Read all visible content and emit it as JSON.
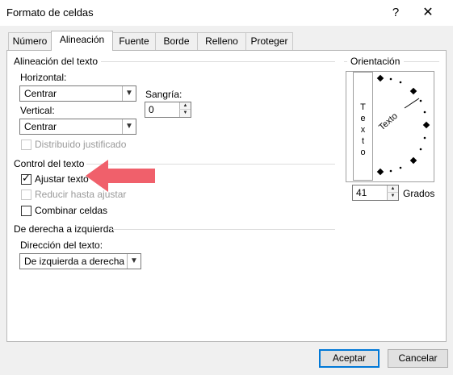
{
  "window": {
    "title": "Formato de celdas",
    "help_label": "?",
    "close_label": "✕"
  },
  "tabs": [
    {
      "label": "Número"
    },
    {
      "label": "Alineación"
    },
    {
      "label": "Fuente"
    },
    {
      "label": "Borde"
    },
    {
      "label": "Relleno"
    },
    {
      "label": "Proteger"
    }
  ],
  "active_tab": "Alineación",
  "text_alignment": {
    "group_title": "Alineación del texto",
    "horizontal_label": "Horizontal:",
    "horizontal_value": "Centrar",
    "indent_label": "Sangría:",
    "indent_value": "0",
    "vertical_label": "Vertical:",
    "vertical_value": "Centrar",
    "distributed_label": "Distribuido justificado",
    "distributed_checked": false,
    "distributed_enabled": false
  },
  "text_control": {
    "group_title": "Control del texto",
    "wrap_label": "Ajustar texto",
    "wrap_checked": true,
    "shrink_label": "Reducir hasta ajustar",
    "shrink_checked": false,
    "shrink_enabled": false,
    "merge_label": "Combinar celdas",
    "merge_checked": false
  },
  "rtl": {
    "group_title": "De derecha a izquierda",
    "direction_label": "Dirección del texto:",
    "direction_value": "De izquierda a derecha"
  },
  "orientation": {
    "group_title": "Orientación",
    "vertical_text_letters": [
      "T",
      "e",
      "x",
      "t",
      "o"
    ],
    "dial_text": "Texto",
    "degrees_value": "41",
    "degrees_label": "Grados"
  },
  "footer": {
    "ok_label": "Aceptar",
    "cancel_label": "Cancelar"
  },
  "colors": {
    "annotation_arrow": "#f0606b",
    "default_button_border": "#0078d7"
  }
}
